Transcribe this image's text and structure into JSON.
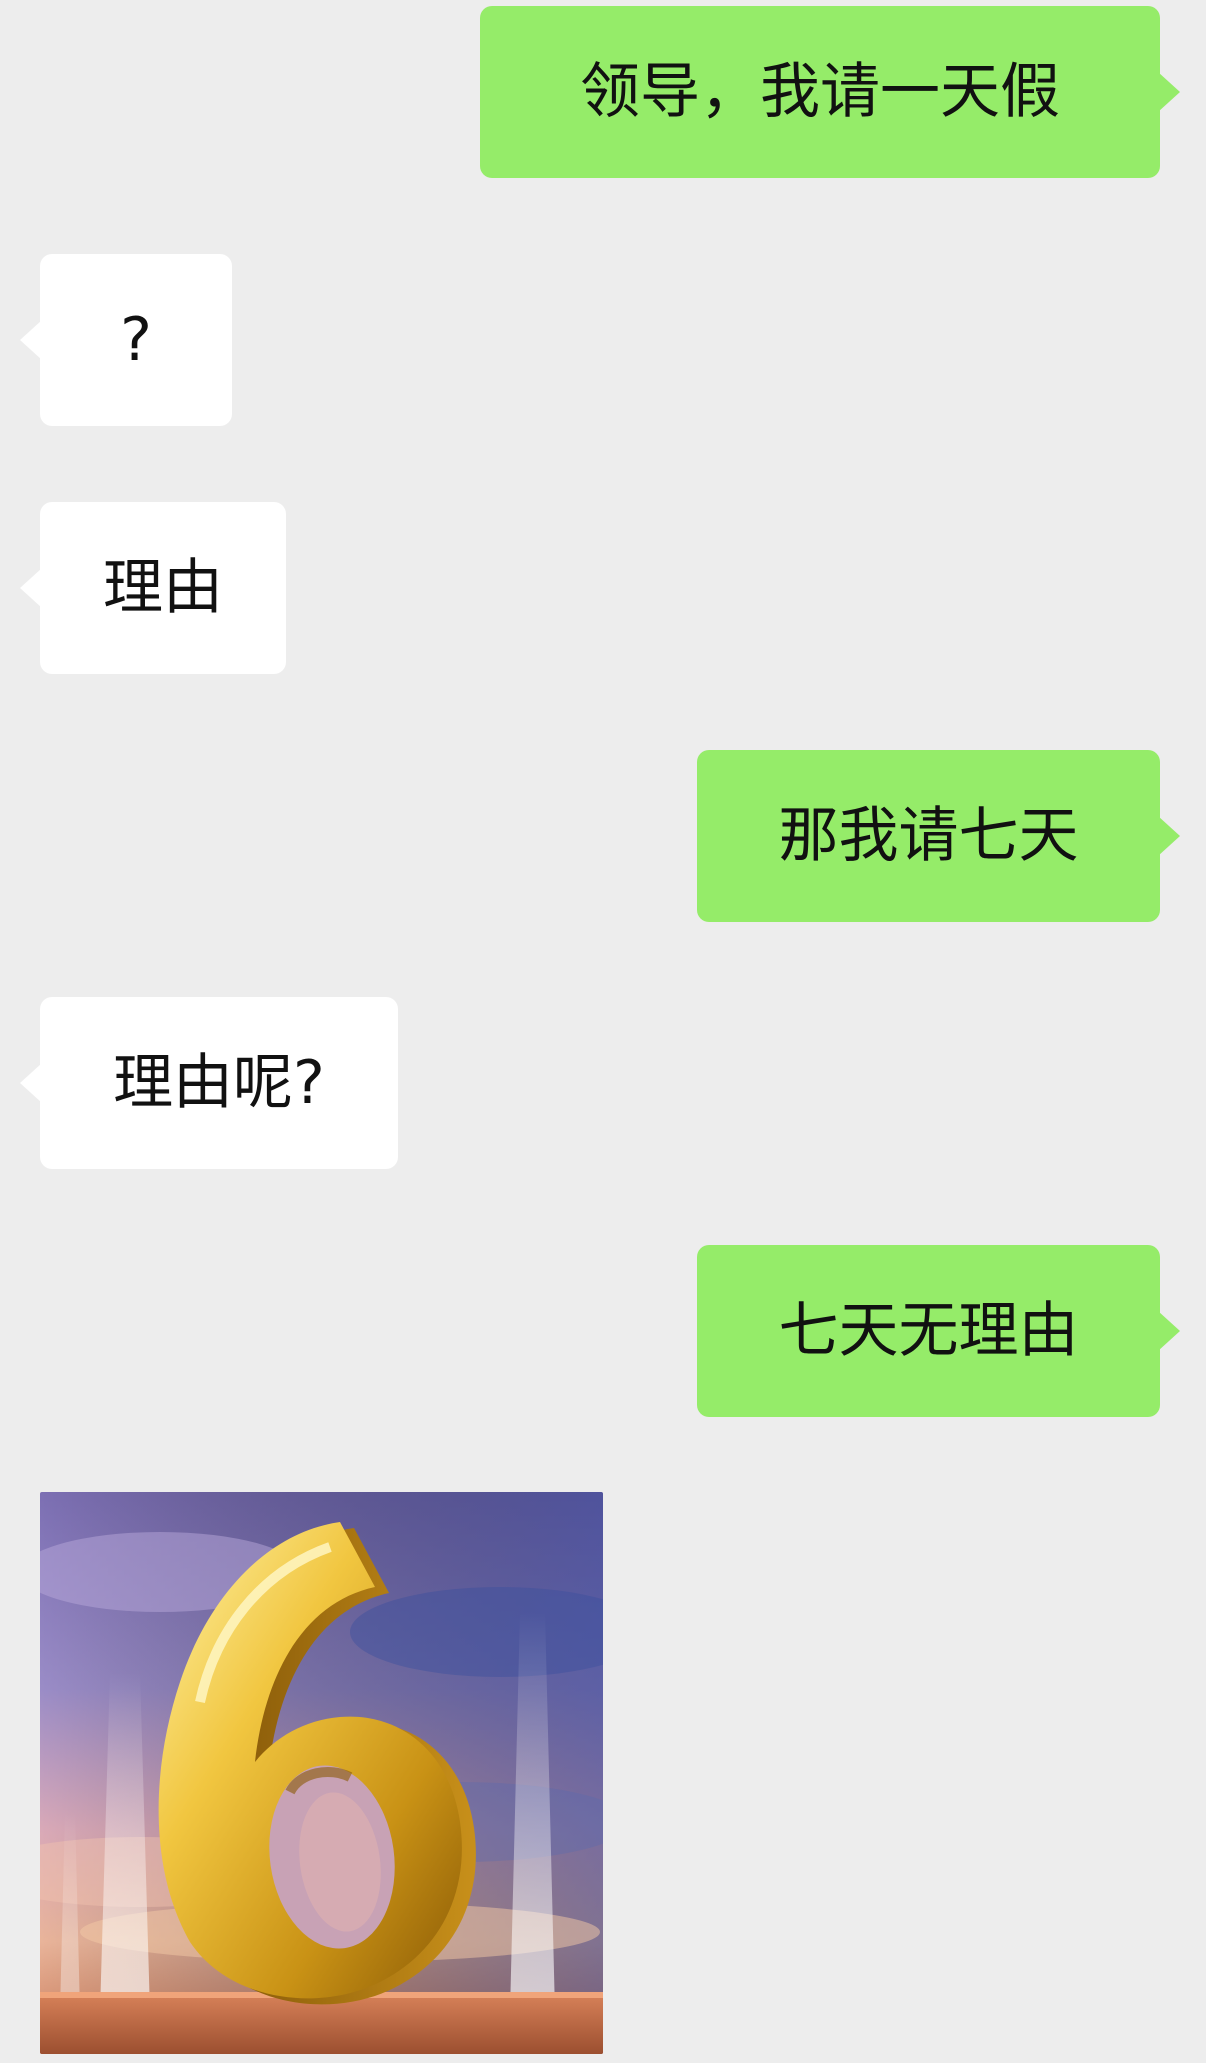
{
  "messages": [
    {
      "side": "sent",
      "text": "领导，我请一天假"
    },
    {
      "side": "received",
      "text": "?"
    },
    {
      "side": "received",
      "text": "理由"
    },
    {
      "side": "sent",
      "text": "那我请七天"
    },
    {
      "side": "received",
      "text": "理由呢?"
    },
    {
      "side": "sent",
      "text": "七天无理由"
    }
  ],
  "image_message": {
    "side": "received",
    "digit": "6"
  },
  "colors": {
    "background": "#ededed",
    "sent_bubble": "#95ec69",
    "received_bubble": "#ffffff",
    "text": "#111111"
  }
}
